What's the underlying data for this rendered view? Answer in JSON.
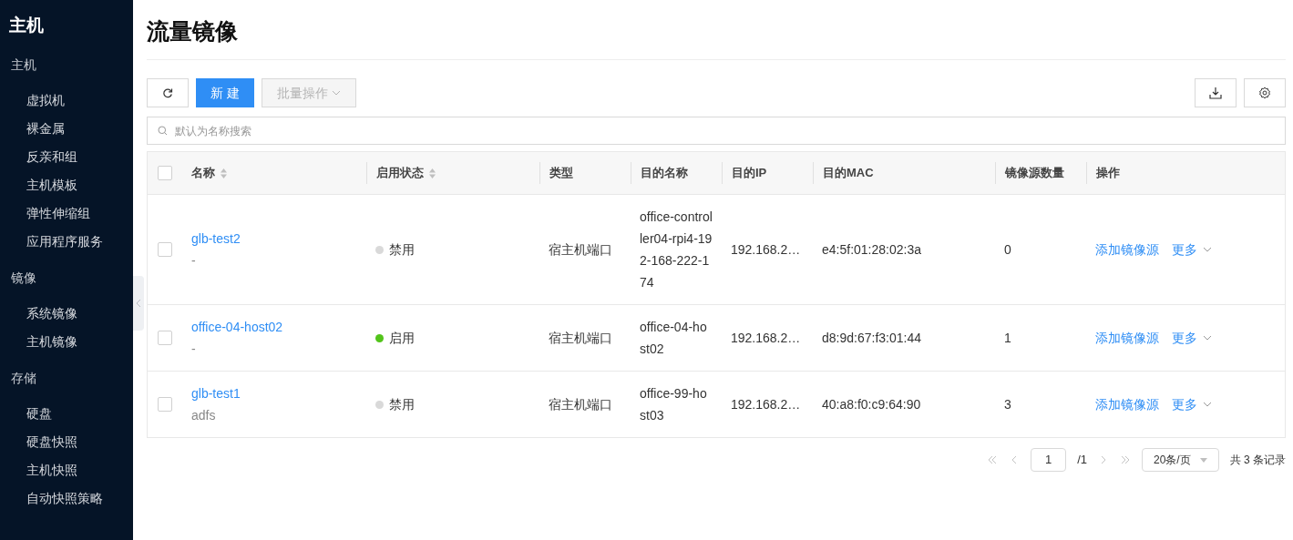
{
  "sidebar": {
    "title": "主机",
    "groups": [
      {
        "label": "主机",
        "items": [
          {
            "label": "虚拟机"
          },
          {
            "label": "裸金属"
          },
          {
            "label": "反亲和组"
          },
          {
            "label": "主机模板"
          },
          {
            "label": "弹性伸缩组"
          },
          {
            "label": "应用程序服务"
          }
        ]
      },
      {
        "label": "镜像",
        "items": [
          {
            "label": "系统镜像"
          },
          {
            "label": "主机镜像"
          }
        ]
      },
      {
        "label": "存储",
        "items": [
          {
            "label": "硬盘"
          },
          {
            "label": "硬盘快照"
          },
          {
            "label": "主机快照"
          },
          {
            "label": "自动快照策略"
          }
        ]
      }
    ]
  },
  "page_title": "流量镜像",
  "toolbar": {
    "create": "新 建",
    "batch": {
      "label": "批量操作",
      "disabled": true
    }
  },
  "search": {
    "placeholder": "默认为名称搜索"
  },
  "table": {
    "select_all": false,
    "columns": [
      {
        "label": "名称",
        "sortable": true
      },
      {
        "label": "启用状态",
        "sortable": true
      },
      {
        "label": "类型",
        "sortable": false
      },
      {
        "label": "目的名称",
        "sortable": false
      },
      {
        "label": "目的IP",
        "sortable": false
      },
      {
        "label": "目的MAC",
        "sortable": false
      },
      {
        "label": "镜像源数量",
        "sortable": false
      },
      {
        "label": "操作",
        "sortable": false
      }
    ],
    "rows": [
      {
        "checked": false,
        "name": "glb-test2",
        "description": "-",
        "status": {
          "text": "禁用",
          "color": "#d9d9d9"
        },
        "type": "宿主机端口",
        "dest_name": "office-controller04-rpi4-192-168-222-174",
        "dest_ip": "192.168.2…",
        "dest_mac": "e4:5f:01:28:02:3a",
        "source_count": "0",
        "action": "添加镜像源",
        "more": "更多"
      },
      {
        "checked": false,
        "name": "office-04-host02",
        "description": "-",
        "status": {
          "text": "启用",
          "color": "#52c41a"
        },
        "type": "宿主机端口",
        "dest_name": "office-04-host02",
        "dest_ip": "192.168.2…",
        "dest_mac": "d8:9d:67:f3:01:44",
        "source_count": "1",
        "action": "添加镜像源",
        "more": "更多"
      },
      {
        "checked": false,
        "name": "glb-test1",
        "description": "adfs",
        "status": {
          "text": "禁用",
          "color": "#d9d9d9"
        },
        "type": "宿主机端口",
        "dest_name": "office-99-host03",
        "dest_ip": "192.168.2…",
        "dest_mac": "40:a8:f0:c9:64:90",
        "source_count": "3",
        "action": "添加镜像源",
        "more": "更多"
      }
    ]
  },
  "pagination": {
    "page": "1",
    "total_pages": "/1",
    "page_size": "20条/页",
    "summary": "共 3 条记录"
  }
}
